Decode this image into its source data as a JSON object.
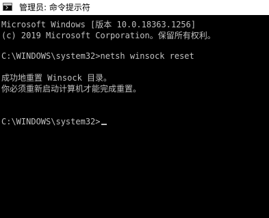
{
  "window": {
    "title": "管理员: 命令提示符",
    "icon": "cmd-icon"
  },
  "console": {
    "lines": [
      "Microsoft Windows [版本 10.0.18363.1256]",
      "(c) 2019 Microsoft Corporation。保留所有权利。",
      "",
      "C:\\WINDOWS\\system32>netsh winsock reset",
      "",
      "成功地重置 Winsock 目录。",
      "你必须重新启动计算机才能完成重置。",
      "",
      "",
      "C:\\WINDOWS\\system32>"
    ],
    "colors": {
      "background": "#000000",
      "foreground": "#c0c0c0"
    }
  }
}
